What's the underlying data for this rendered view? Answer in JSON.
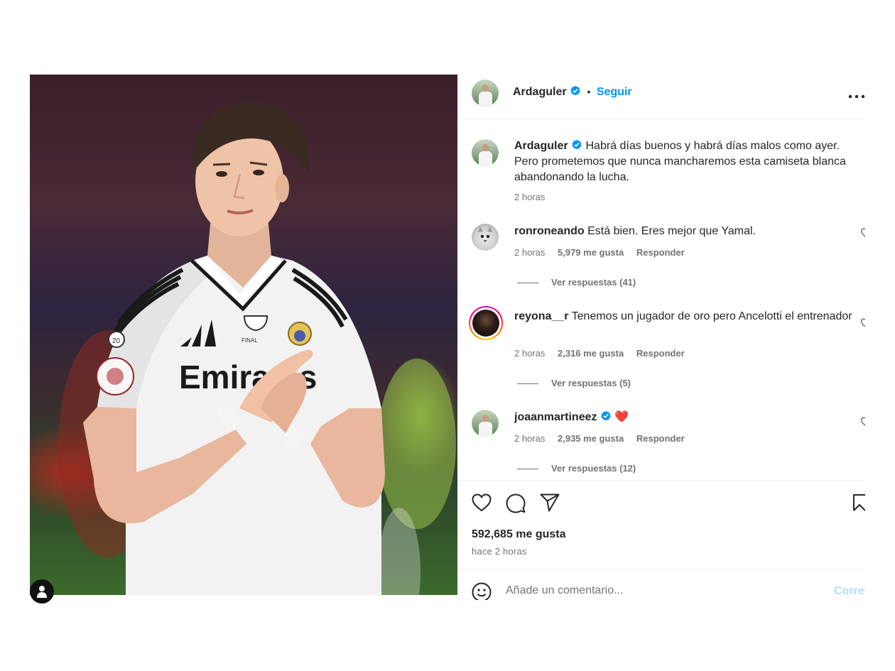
{
  "post": {
    "author": "Ardaguler",
    "follow_label": "Seguir",
    "separator": "•",
    "caption": {
      "username": "Ardaguler",
      "text": "Habrá días buenos y habrá días malos como ayer. Pero prometemos que nunca mancharemos esta camiseta blanca abandonando la lucha.",
      "time": "2 horas"
    },
    "comments": [
      {
        "username": "ronroneando",
        "text": "Está bien. Eres mejor que Yamal.",
        "time": "2 horas",
        "likes": "5,979 me gusta",
        "reply_label": "Responder",
        "replies_label": "Ver respuestas (41)"
      },
      {
        "username": "reyona__r",
        "text": "Tenemos un jugador de oro pero Ancelotti el entrenador",
        "time": "2 horas",
        "likes": "2,316 me gusta",
        "reply_label": "Responder",
        "replies_label": "Ver respuestas (5)"
      },
      {
        "username": "joaanmartineez",
        "text": "❤️",
        "time": "2 horas",
        "likes": "2,935 me gusta",
        "reply_label": "Responder",
        "replies_label": "Ver respuestas (12)"
      }
    ],
    "likes_count": "592,685 me gusta",
    "posted_ago": "hace 2 horas",
    "comment_placeholder": "Añade un comentario...",
    "post_button": "Correo",
    "photo_print": {
      "sponsor": "Emirates",
      "patch_number": "20",
      "final_text": "FINAL"
    }
  },
  "icons": {
    "verified": "verified-badge-icon",
    "more": "more-options-icon",
    "like": "heart-icon",
    "comment": "comment-bubble-icon",
    "share": "paper-plane-icon",
    "save": "bookmark-icon",
    "emoji": "emoji-icon",
    "tag": "user-tag-icon"
  },
  "colors": {
    "accent": "#0095f6",
    "verified": "#0095f6",
    "heart": "#e6192b",
    "post_disabled": "#b3dbff"
  }
}
